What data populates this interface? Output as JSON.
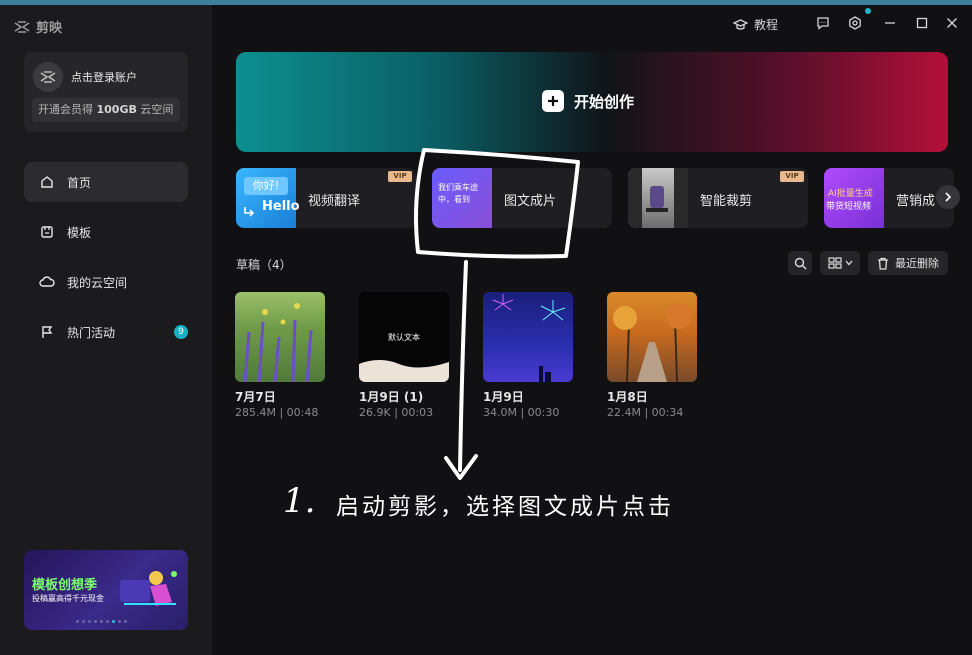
{
  "app": {
    "name": "剪映"
  },
  "sidebar": {
    "login_text": "点击登录账户",
    "vip_prefix": "开通会员得 ",
    "vip_amount": "100GB",
    "vip_suffix": " 云空间",
    "nav": [
      {
        "label": "首页",
        "icon": "home-icon"
      },
      {
        "label": "模板",
        "icon": "template-icon"
      },
      {
        "label": "我的云空间",
        "icon": "cloud-icon"
      },
      {
        "label": "热门活动",
        "icon": "flag-icon",
        "badge": "9"
      }
    ],
    "promo": {
      "title": "模板创想季",
      "subtitle": "投稿赢高得千元现金"
    }
  },
  "titlebar": {
    "tutorial_label": "教程"
  },
  "hero": {
    "label": "开始创作"
  },
  "features": [
    {
      "label": "视频翻译",
      "vip": "VIP",
      "thumb_text_1": "你好!",
      "thumb_text_2": "Hello"
    },
    {
      "label": "图文成片",
      "vip": "",
      "thumb_text": "我们乘车途中，看到"
    },
    {
      "label": "智能裁剪",
      "vip": "VIP"
    },
    {
      "label": "营销成",
      "vip": "",
      "thumb_text_1": "AI批量生成",
      "thumb_text_2": "带货短视频"
    }
  ],
  "drafts": {
    "title": "草稿（4）",
    "delete_label": "最近删除",
    "items": [
      {
        "title": "7月7日",
        "meta": "285.4M | 00:48"
      },
      {
        "title": "1月9日 (1)",
        "meta": "26.9K | 00:03",
        "thumb_text": "默认文本"
      },
      {
        "title": "1月9日",
        "meta": "34.0M | 00:30"
      },
      {
        "title": "1月8日",
        "meta": "22.4M | 00:34"
      }
    ]
  },
  "annotation": {
    "number": "1.",
    "text": "启动剪影，选择图文成片点击"
  },
  "colors": {
    "accent": "#19b0c6",
    "vip_tag": "#e7b98d",
    "promo_green": "#7dff6e"
  }
}
